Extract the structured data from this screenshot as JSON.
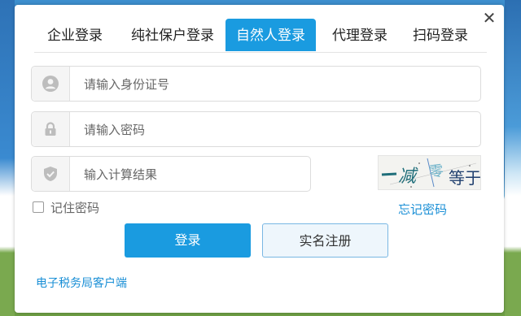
{
  "tabs": [
    {
      "label": "企业登录",
      "active": false
    },
    {
      "label": "纯社保户登录",
      "active": false
    },
    {
      "label": "自然人登录",
      "active": true
    },
    {
      "label": "代理登录",
      "active": false
    },
    {
      "label": "扫码登录",
      "active": false
    }
  ],
  "form": {
    "id_placeholder": "请输入身份证号",
    "password_placeholder": "请输入密码",
    "captcha_placeholder": "输入计算结果",
    "remember_label": "记住密码",
    "forgot_label": "忘记密码",
    "login_button": "登录",
    "register_button": "实名注册"
  },
  "captcha": {
    "text": "一减零等于?"
  },
  "footer": {
    "client_link": "电子税务局客户端"
  },
  "icons": {
    "close": "close-icon",
    "id": "user-icon",
    "password": "lock-icon",
    "captcha": "shield-icon"
  },
  "colors": {
    "accent": "#1a9be0",
    "link": "#1a8fd6"
  }
}
